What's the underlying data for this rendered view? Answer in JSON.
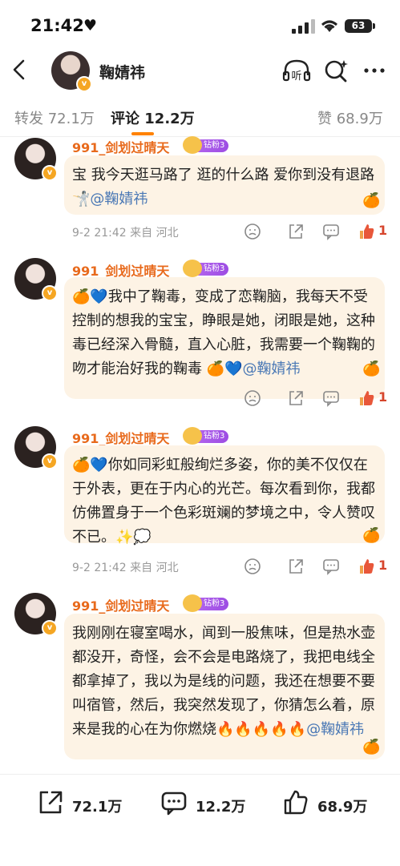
{
  "status_bar": {
    "time": "21:42",
    "battery": "63"
  },
  "header": {
    "username": "鞠婧祎",
    "listen_label": "听"
  },
  "tabs": [
    {
      "label": "转发",
      "count": "72.1万"
    },
    {
      "label": "评论",
      "count": "12.2万",
      "active": true
    },
    {
      "label": "赞",
      "count": "68.9万"
    }
  ],
  "comments": [
    {
      "author": "991_剑划过晴天",
      "badge": "钻粉3",
      "text": "宝 我今天逛马路了 逛的什么路 爱你到没有退路🤺",
      "mention": "@鞠婧祎",
      "time": "9-2 21:42",
      "location": "来自 河北",
      "likes": "1"
    },
    {
      "author": "991_剑划过晴天",
      "badge": "钻粉3",
      "text": "🍊💙我中了鞠毒，变成了恋鞠脑，我每天不受控制的想我的宝宝，睁眼是她，闭眼是她，这种毒已经深入骨髓，直入心脏，我需要一个鞠鞠的吻才能治好我的鞠毒 🍊💙",
      "mention": "@鞠婧祎",
      "time": "",
      "location": "",
      "likes": "1"
    },
    {
      "author": "991_剑划过晴天",
      "badge": "钻粉3",
      "text": "🍊💙你如同彩虹般绚烂多姿，你的美不仅仅在于外表，更在于内心的光芒。每次看到你，我都仿佛置身于一个色彩斑斓的梦境之中，令人赞叹不已。✨💭",
      "mention": "",
      "time": "9-2 21:42",
      "location": "来自 河北",
      "likes": "1"
    },
    {
      "author": "991_剑划过晴天",
      "badge": "钻粉3",
      "text": "我刚刚在寝室喝水，闻到一股焦味，但是热水壶都没开，奇怪，会不会是电路烧了，我把电线全都拿掉了，我以为是线的问题，我还在想要不要叫宿管，然后，我突然发现了，你猜怎么着，原来是我的心在为你燃烧🔥🔥🔥🔥🔥",
      "mention": "@鞠婧祎",
      "time": "",
      "location": "",
      "likes": ""
    }
  ],
  "bottom_bar": {
    "repost": "72.1万",
    "comment": "12.2万",
    "like": "68.9万"
  },
  "colors": {
    "accent": "#ff8200",
    "name": "#e86a1c",
    "mention": "#4a78b5",
    "bubble": "#fdf3e5"
  }
}
